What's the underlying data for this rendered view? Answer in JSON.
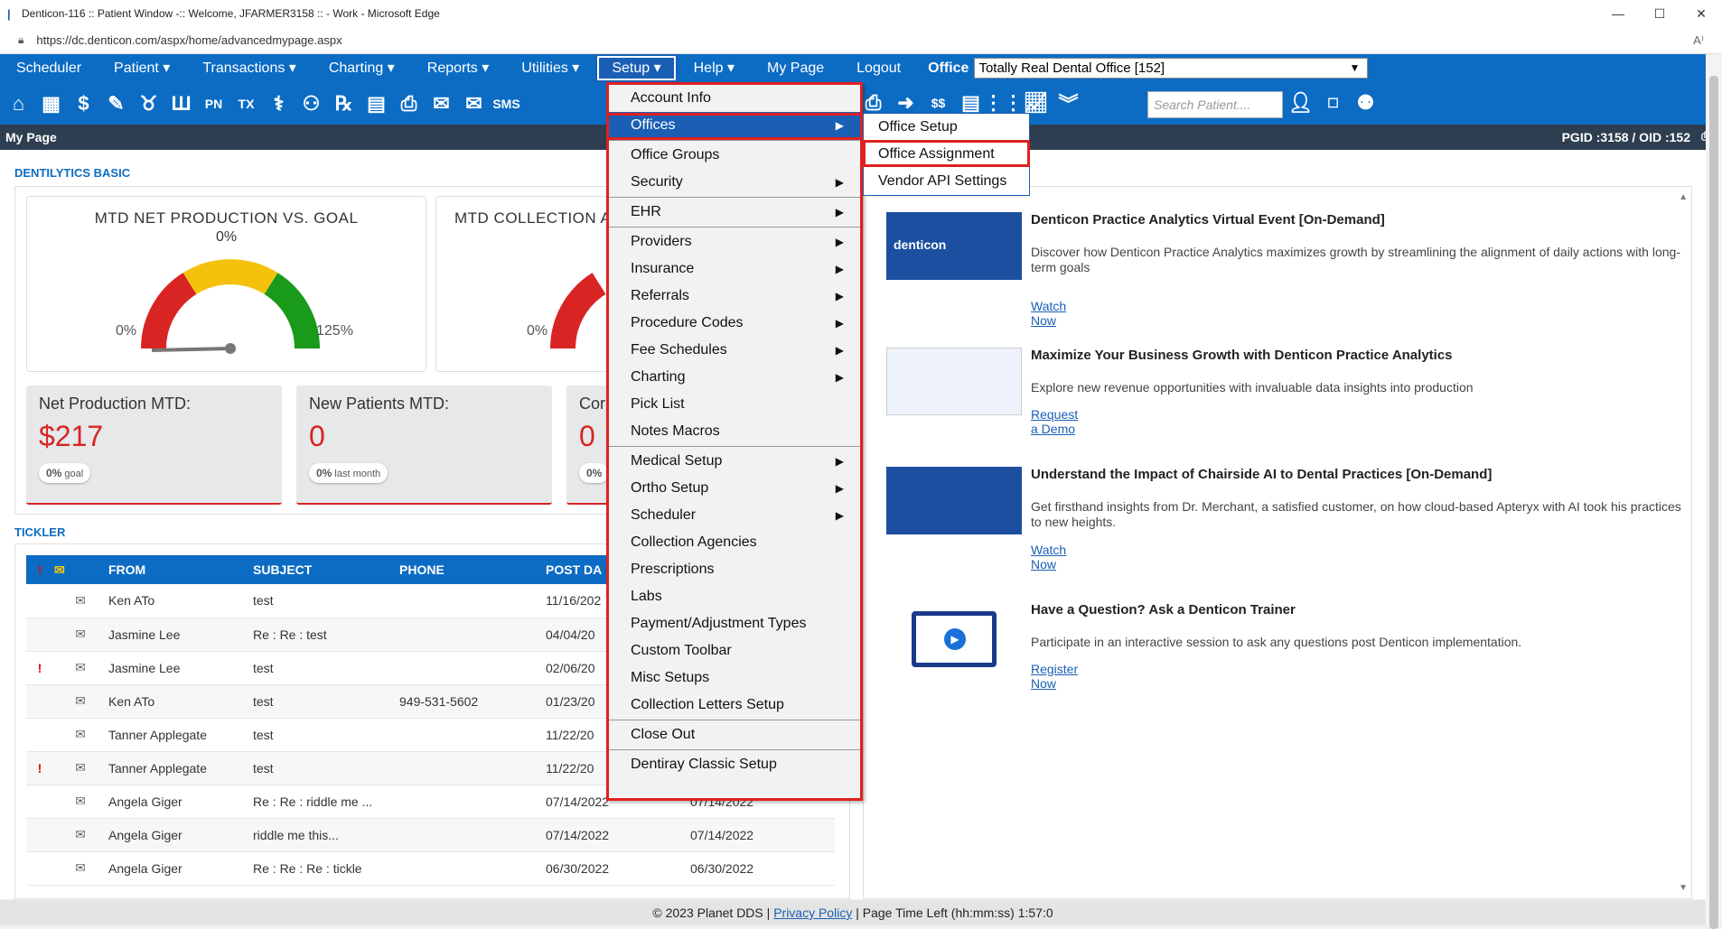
{
  "browser": {
    "title": "Denticon-116 :: Patient Window -:: Welcome, JFARMER3158 :: - Work - Microsoft Edge",
    "url": "https://dc.denticon.com/aspx/home/advancedmypage.aspx"
  },
  "menu": {
    "items": [
      "Scheduler",
      "Patient ▾",
      "Transactions ▾",
      "Charting ▾",
      "Reports ▾",
      "Utilities ▾",
      "Setup ▾",
      "Help ▾",
      "My Page",
      "Logout"
    ],
    "office_label": "Office",
    "office_value": "Totally Real Dental Office [152]"
  },
  "toolbar": {
    "search_placeholder": "Search Patient...."
  },
  "pagebar": {
    "title": "My Page",
    "ids": "PGID :3158 / OID :152"
  },
  "dentilytics": {
    "title": "DENTILYTICS BASIC",
    "gauge1": {
      "title": "MTD NET PRODUCTION VS. GOAL",
      "value": "0%",
      "min": "0%",
      "max": "125%"
    },
    "gauge2": {
      "title": "MTD COLLECTION A",
      "min": "0%"
    },
    "cards": [
      {
        "label": "Net Production MTD:",
        "value": "$217",
        "badge_pct": "0%",
        "badge_text": "goal"
      },
      {
        "label": "New Patients MTD:",
        "value": "0",
        "badge_pct": "0%",
        "badge_text": "last month"
      },
      {
        "label": "Cor",
        "value": "0",
        "badge_pct": "0%",
        "badge_text": ""
      }
    ]
  },
  "tickler": {
    "title": "TICKLER",
    "headers": [
      "FROM",
      "SUBJECT",
      "PHONE",
      "POST DA"
    ],
    "rows": [
      {
        "flag": "",
        "from": "Ken ATo",
        "subject": "test",
        "phone": "",
        "post": "11/16/202",
        "due": ""
      },
      {
        "flag": "",
        "from": "Jasmine Lee",
        "subject": "Re : Re : test",
        "phone": "",
        "post": "04/04/20",
        "due": ""
      },
      {
        "flag": "!",
        "from": "Jasmine Lee",
        "subject": "test",
        "phone": "",
        "post": "02/06/20",
        "due": ""
      },
      {
        "flag": "",
        "from": "Ken ATo",
        "subject": "test",
        "phone": "949-531-5602",
        "post": "01/23/20",
        "due": ""
      },
      {
        "flag": "",
        "from": "Tanner Applegate",
        "subject": "test",
        "phone": "",
        "post": "11/22/20",
        "due": ""
      },
      {
        "flag": "!",
        "from": "Tanner Applegate",
        "subject": "test",
        "phone": "",
        "post": "11/22/20",
        "due": ""
      },
      {
        "flag": "",
        "from": "Angela Giger",
        "subject": "Re : Re : riddle me ...",
        "phone": "",
        "post": "07/14/2022",
        "due": "07/14/2022"
      },
      {
        "flag": "",
        "from": "Angela Giger",
        "subject": "riddle me this...",
        "phone": "",
        "post": "07/14/2022",
        "due": "07/14/2022"
      },
      {
        "flag": "",
        "from": "Angela Giger",
        "subject": "Re : Re : Re : tickle",
        "phone": "",
        "post": "06/30/2022",
        "due": "06/30/2022"
      }
    ]
  },
  "news": [
    {
      "title": "Denticon Practice Analytics Virtual Event [On-Demand]",
      "desc": "Discover how Denticon Practice Analytics maximizes growth by streamlining the alignment of daily actions with long-term goals",
      "link": "Watch Now",
      "thumb_text": "denticon"
    },
    {
      "title": "Maximize Your Business Growth with Denticon Practice Analytics",
      "desc": "Explore new revenue opportunities with invaluable data insights into production",
      "link": "Request a Demo"
    },
    {
      "title": "Understand the Impact of Chairside AI to Dental Practices [On-Demand]",
      "desc": "Get firsthand insights from Dr. Merchant, a satisfied customer, on how cloud-based Apteryx with AI took his practices to new heights.",
      "link": "Watch Now"
    },
    {
      "title": "Have a Question? Ask a Denticon Trainer",
      "desc": "Participate in an interactive session to ask any questions post Denticon implementation.",
      "link": "Register Now"
    }
  ],
  "setup_menu": [
    {
      "label": "Account Info",
      "arrow": false,
      "sep_after": false
    },
    {
      "label": "Offices",
      "arrow": true,
      "sep_after": true
    },
    {
      "label": "Office Groups",
      "arrow": false,
      "sep_after": false
    },
    {
      "label": "Security",
      "arrow": true,
      "sep_after": true
    },
    {
      "label": "EHR",
      "arrow": true,
      "sep_after": true
    },
    {
      "label": "Providers",
      "arrow": true,
      "sep_after": false
    },
    {
      "label": "Insurance",
      "arrow": true,
      "sep_after": false
    },
    {
      "label": "Referrals",
      "arrow": true,
      "sep_after": false
    },
    {
      "label": "Procedure Codes",
      "arrow": true,
      "sep_after": false
    },
    {
      "label": "Fee Schedules",
      "arrow": true,
      "sep_after": false
    },
    {
      "label": "Charting",
      "arrow": true,
      "sep_after": false
    },
    {
      "label": "Pick List",
      "arrow": false,
      "sep_after": false
    },
    {
      "label": "Notes Macros",
      "arrow": false,
      "sep_after": true
    },
    {
      "label": "Medical Setup",
      "arrow": true,
      "sep_after": false
    },
    {
      "label": "Ortho Setup",
      "arrow": true,
      "sep_after": false
    },
    {
      "label": "Scheduler",
      "arrow": true,
      "sep_after": false
    },
    {
      "label": "Collection Agencies",
      "arrow": false,
      "sep_after": false
    },
    {
      "label": "Prescriptions",
      "arrow": false,
      "sep_after": false
    },
    {
      "label": "Labs",
      "arrow": false,
      "sep_after": false
    },
    {
      "label": "Payment/Adjustment Types",
      "arrow": false,
      "sep_after": false
    },
    {
      "label": "Custom Toolbar",
      "arrow": false,
      "sep_after": false
    },
    {
      "label": "Misc Setups",
      "arrow": false,
      "sep_after": false
    },
    {
      "label": "Collection Letters Setup",
      "arrow": false,
      "sep_after": true
    },
    {
      "label": "Close Out",
      "arrow": false,
      "sep_after": true
    },
    {
      "label": "Dentiray Classic Setup",
      "arrow": false,
      "sep_after": false
    }
  ],
  "offices_submenu": [
    "Office Setup",
    "Office Assignment",
    "Vendor API Settings"
  ],
  "footer": {
    "copyright": "© 2023 Planet DDS | ",
    "privacy": "Privacy Policy",
    "time": " | Page Time Left (hh:mm:ss) 1:57:0"
  }
}
